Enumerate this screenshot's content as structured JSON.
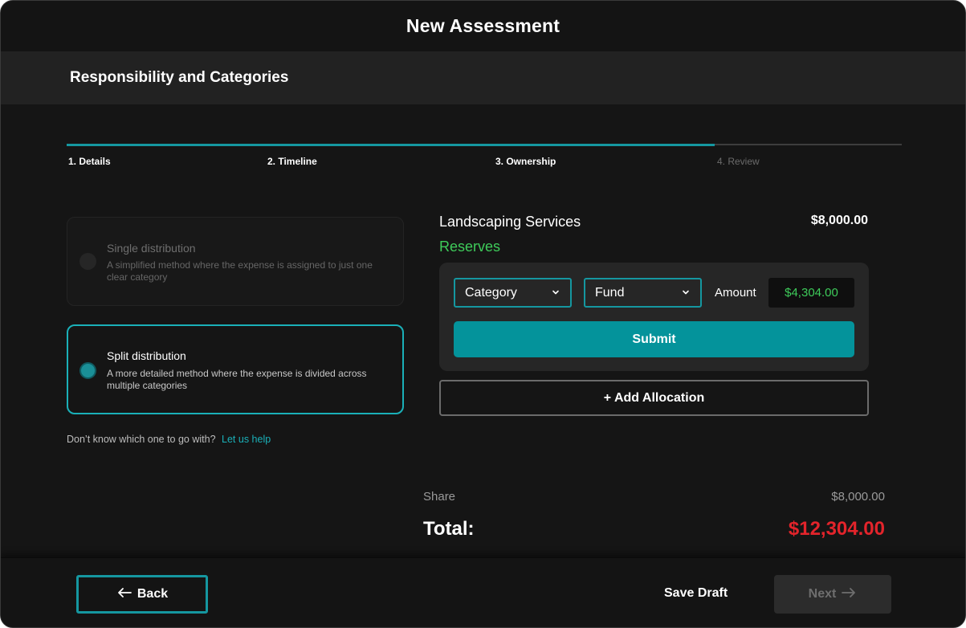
{
  "header": {
    "title": "New Assessment"
  },
  "section": {
    "title": "Responsibility and Categories"
  },
  "stepper": {
    "progress_fraction": 0.776,
    "steps": [
      {
        "label": "1. Details",
        "state": "complete"
      },
      {
        "label": "2. Timeline",
        "state": "complete"
      },
      {
        "label": "3. Ownership",
        "state": "current"
      },
      {
        "label": "4. Review",
        "state": "upcoming"
      }
    ]
  },
  "options": {
    "single": {
      "title": "Single distribution",
      "description": "A simplified method where the expense is assigned to just one clear category",
      "selected": false
    },
    "split": {
      "title": "Split distribution",
      "description": "A more detailed method where the expense is divided across multiple categories",
      "selected": true
    }
  },
  "help": {
    "text": "Don’t know which one to go with?",
    "link": "Let us help"
  },
  "allocation": {
    "service_name": "Landscaping Services",
    "service_amount": "$8,000.00",
    "reserve_label": "Reserves",
    "category_select": "Category",
    "fund_select": "Fund",
    "amount_label": "Amount",
    "amount_value": "$4,304.00",
    "submit_label": "Submit",
    "add_label": "+ Add Allocation"
  },
  "summary": {
    "share_label": "Share",
    "share_value": "$8,000.00",
    "total_label": "Total:",
    "total_value": "$12,304.00"
  },
  "footer": {
    "back_label": "Back",
    "save_label": "Save Draft",
    "next_label": "Next"
  },
  "colors": {
    "accent": "#1597a0",
    "positive": "#3ecb5a",
    "negative": "#e3242b"
  }
}
